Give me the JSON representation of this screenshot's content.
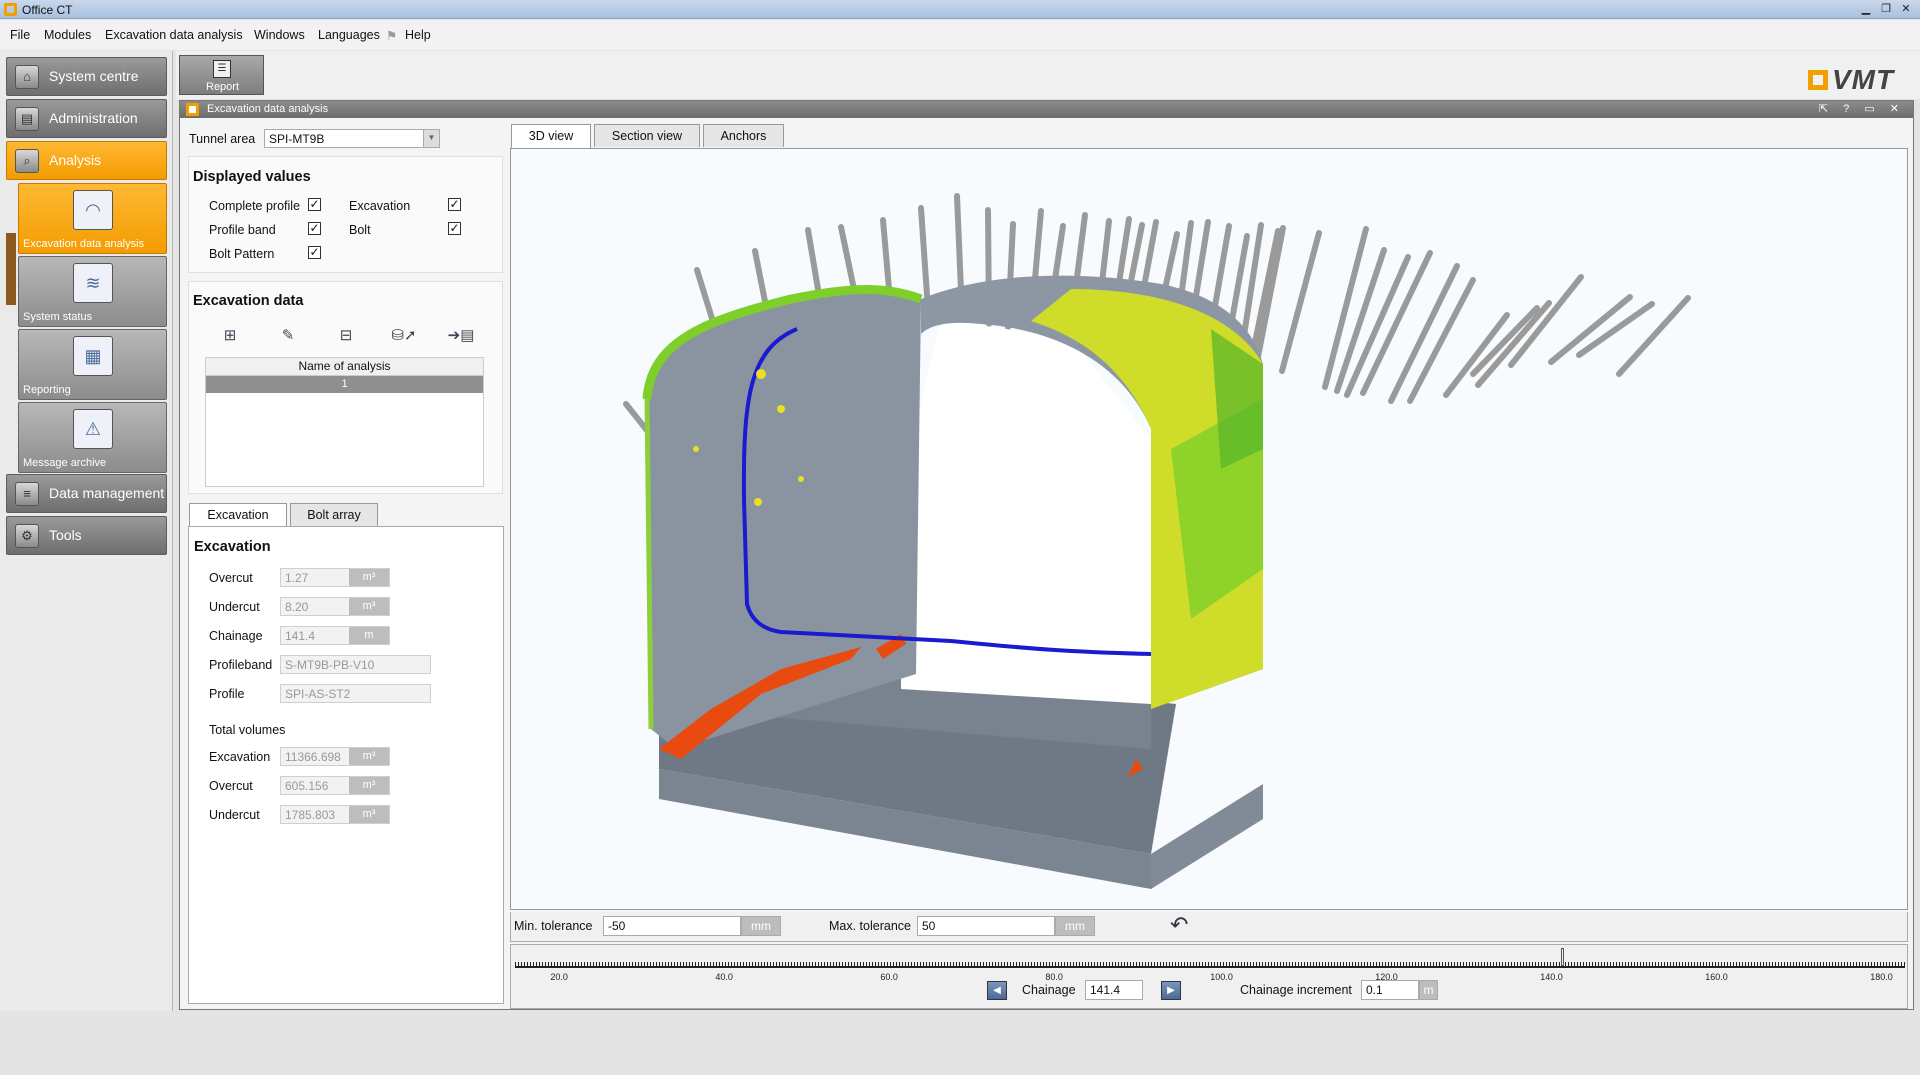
{
  "window": {
    "title": "Office CT",
    "minimize": "▁",
    "maximize": "❐",
    "close": "✕"
  },
  "menu": [
    "File",
    "Modules",
    "Excavation data analysis",
    "Windows",
    "Languages",
    "Help"
  ],
  "nav": {
    "system_centre": "System centre",
    "administration": "Administration",
    "analysis": "Analysis",
    "sub": [
      "Excavation data analysis",
      "System status",
      "Reporting",
      "Message archive"
    ],
    "data_management": "Data management",
    "tools": "Tools"
  },
  "toolbar": {
    "report": "Report"
  },
  "brand": "VMT",
  "doc": {
    "title": "Excavation data analysis",
    "controls": "⇱ ? ▭ ✕"
  },
  "tunnel": {
    "label": "Tunnel area",
    "value": "SPI-MT9B"
  },
  "displayed": {
    "heading": "Displayed values",
    "items": [
      {
        "label": "Complete profile",
        "checked": "✓"
      },
      {
        "label": "Excavation",
        "checked": "✓"
      },
      {
        "label": "Profile band",
        "checked": "✓"
      },
      {
        "label": "Bolt",
        "checked": "✓"
      },
      {
        "label": "Bolt Pattern",
        "checked": "✓"
      }
    ]
  },
  "excavation_data": {
    "heading": "Excavation data",
    "icons": [
      "add-icon",
      "edit-icon",
      "remove-icon",
      "database-export-icon",
      "csv-export-icon"
    ],
    "table_header": "Name of analysis",
    "rows": [
      "1"
    ]
  },
  "lower_tabs": [
    "Excavation",
    "Bolt array"
  ],
  "excavation": {
    "heading": "Excavation",
    "fields": [
      {
        "label": "Overcut",
        "value": "1.27",
        "unit": "m³"
      },
      {
        "label": "Undercut",
        "value": "8.20",
        "unit": "m³"
      },
      {
        "label": "Chainage",
        "value": "141.4",
        "unit": "m"
      },
      {
        "label": "Profileband",
        "value": "S-MT9B-PB-V10",
        "unit": ""
      },
      {
        "label": "Profile",
        "value": "SPI-AS-ST2",
        "unit": ""
      }
    ],
    "total_heading": "Total volumes",
    "totals": [
      {
        "label": "Excavation",
        "value": "11366.698",
        "unit": "m³"
      },
      {
        "label": "Overcut",
        "value": "605.156",
        "unit": "m³"
      },
      {
        "label": "Undercut",
        "value": "1785.803",
        "unit": "m³"
      }
    ]
  },
  "view_tabs": [
    "3D view",
    "Section view",
    "Anchors"
  ],
  "tolerance": {
    "min_label": "Min. tolerance",
    "min_value": "-50",
    "min_unit": "mm",
    "max_label": "Max. tolerance",
    "max_value": "50",
    "max_unit": "mm"
  },
  "ruler": {
    "ticks": [
      "20.0",
      "40.0",
      "60.0",
      "80.0",
      "100.0",
      "120.0",
      "140.0",
      "160.0",
      "180.0"
    ],
    "position": 141.4,
    "min": 14.5,
    "max": 183.0
  },
  "chainage": {
    "label": "Chainage",
    "value": "141.4",
    "increment_label": "Chainage increment",
    "increment_value": "0.1",
    "unit": "m"
  },
  "colors": {
    "accent": "#f39c00",
    "tunnel_grey": "#7f8a99",
    "good": "#7ecf2a",
    "warn": "#e8e020",
    "bad": "#e84a10",
    "line": "#1a1ad0"
  }
}
